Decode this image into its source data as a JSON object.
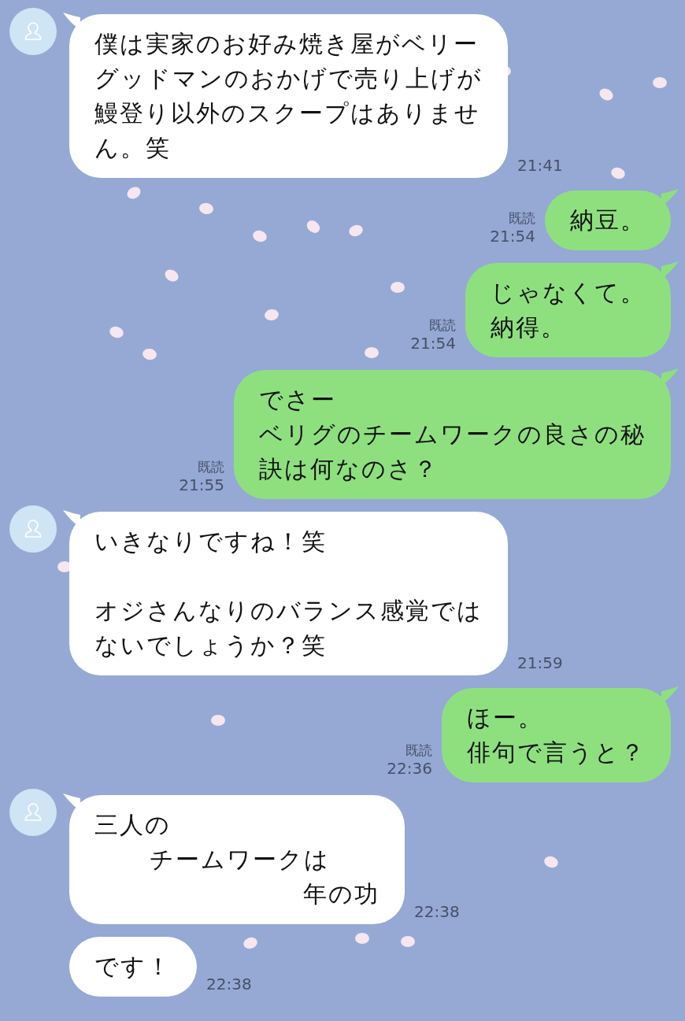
{
  "messages": [
    {
      "kind": "incoming",
      "first": true,
      "paragraphs": [
        [
          {
            "text": "僕は実家のお好み焼き屋がベリー"
          },
          {
            "text": "グッドマンのおかげで売り上げが"
          },
          {
            "text": "鰻登り以外のスクープはありませ"
          },
          {
            "text": "ん。笑"
          }
        ]
      ],
      "time": "21:41"
    },
    {
      "kind": "outgoing",
      "paragraphs": [
        [
          {
            "text": "納豆。"
          }
        ]
      ],
      "read": "既読",
      "time": "21:54"
    },
    {
      "kind": "outgoing",
      "paragraphs": [
        [
          {
            "text": "じゃなくて。"
          },
          {
            "text": "納得。"
          }
        ]
      ],
      "read": "既読",
      "time": "21:54"
    },
    {
      "kind": "outgoing",
      "paragraphs": [
        [
          {
            "text": "でさー"
          },
          {
            "text": "ベリグのチームワークの良さの秘"
          },
          {
            "text": "訣は何なのさ？"
          }
        ]
      ],
      "read": "既読",
      "time": "21:55"
    },
    {
      "kind": "incoming",
      "first": true,
      "paragraphs": [
        [
          {
            "text": "いきなりですね！笑"
          }
        ],
        [
          {
            "text": "オジさんなりのバランス感覚では"
          },
          {
            "text": "ないでしょうか？笑"
          }
        ]
      ],
      "time": "21:59"
    },
    {
      "kind": "outgoing",
      "paragraphs": [
        [
          {
            "text": "ほー。"
          },
          {
            "text": "俳句で言うと？"
          }
        ]
      ],
      "read": "既読",
      "time": "22:36"
    },
    {
      "kind": "incoming",
      "first": true,
      "paragraphs": [
        [
          {
            "text": "三人の",
            "kind": "flush"
          },
          {
            "text": "チームワークは",
            "kind": "indent"
          },
          {
            "text": "年の功",
            "kind": "deep"
          }
        ]
      ],
      "time": "22:38"
    },
    {
      "kind": "incoming",
      "first": false,
      "paragraphs": [
        [
          {
            "text": "です！"
          }
        ]
      ],
      "time": "22:38"
    }
  ]
}
